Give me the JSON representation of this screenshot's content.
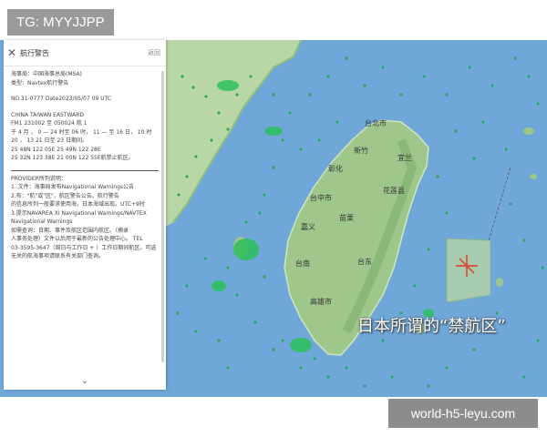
{
  "tag": {
    "text": "TG: MYYJJPP"
  },
  "watermark": {
    "text": "world-h5-leyu.com"
  },
  "panel": {
    "title": "航行警告",
    "header_side": "返回",
    "lines_top": [
      "海事局：中国海事总局(MSA)",
      "类型：Navtex航行警告",
      "",
      "NO.31-0777 Date2023/05/07 09 UTC",
      "",
      "CHINA TAIWAN EASTWARD",
      "FM1 231002 至 050024 航 1",
      "于 4 月 ， 0 — 24 时至 06 时， 11 — 至 16 日， 10 时",
      "20 ， 13 21 日至 23 日期间。",
      "25 48N 122 05E 25 49N 122 28E",
      "25 32N 123 38E 21 00N 122 55E航禁止航区。"
    ],
    "section_title": "PROVIDER所列说明：",
    "lines_bottom": [
      "1. 文件：海事局发布Navigational Warnings公告",
      "2.布：\"航\"或\"区\"，航区警告公告。航行警告",
      "的信息所列一般要求使用海，日本海域出现。UTC+9时",
      "3.提示NAVAREA XI Navigational Warnings/NAVTEX",
      "Navigational Warnings"
    ],
    "lines_bottom2": [
      "如需查询：日期、事件及航区范围内航区。（摘录",
      "人事务处理）文件以后用于最新的公告处理中心。 TEL",
      "03-3595-3647（周日与工作日 + ）工作日期间航区。可选",
      "无关的航海事项请联系有关部门查询。"
    ],
    "collapse_icon": "chevron-down-icon"
  },
  "map": {
    "labels": [
      {
        "text": "台北市"
      },
      {
        "text": "台中市"
      },
      {
        "text": "台南"
      },
      {
        "text": "高雄市"
      },
      {
        "text": "花莲县"
      },
      {
        "text": "台东"
      },
      {
        "text": "嘉义"
      },
      {
        "text": "彰化"
      },
      {
        "text": "新竹"
      },
      {
        "text": "宜兰"
      },
      {
        "text": "苗栗"
      }
    ],
    "zone_label": "日本所谓的“禁航区”"
  }
}
